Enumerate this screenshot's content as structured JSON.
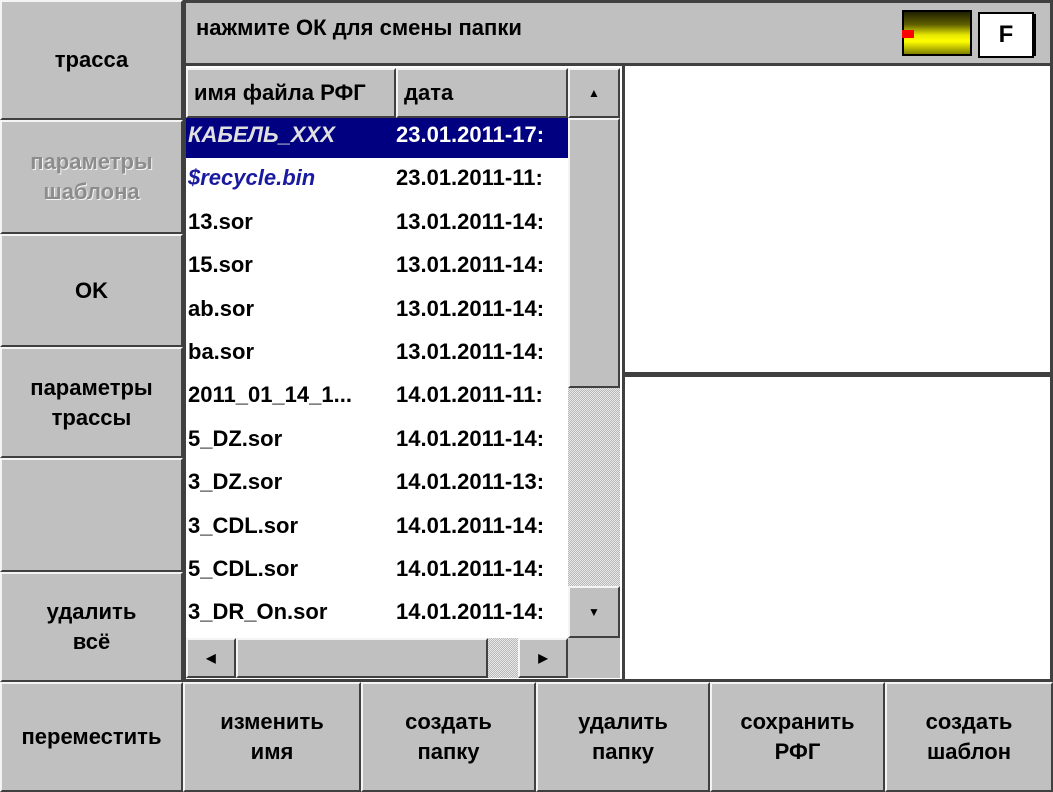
{
  "left_menu": [
    {
      "label": "трасса",
      "disabled": false
    },
    {
      "label": "параметры\nшаблона",
      "disabled": true
    },
    {
      "label": "OK",
      "disabled": false
    },
    {
      "label": "параметры\nтрассы",
      "disabled": false
    },
    {
      "label": "",
      "disabled": false
    },
    {
      "label": "удалить\nвсё",
      "disabled": false
    }
  ],
  "bottom_menu": [
    {
      "label": "переместить"
    },
    {
      "label": "изменить\nимя"
    },
    {
      "label": "создать\nпапку"
    },
    {
      "label": "удалить\nпапку"
    },
    {
      "label": "сохранить\nРФГ"
    },
    {
      "label": "создать\nшаблон"
    }
  ],
  "title_text": "нажмите ОК для смены папки",
  "f_button": "F",
  "file_list": {
    "col_name": "имя файла РФГ",
    "col_date": "дата",
    "rows": [
      {
        "name": "КАБЕЛЬ_XXX",
        "date": "23.01.2011-17:",
        "type": "selected"
      },
      {
        "name": "$recycle.bin",
        "date": "23.01.2011-11:",
        "type": "dir"
      },
      {
        "name": "13.sor",
        "date": "13.01.2011-14:",
        "type": "file"
      },
      {
        "name": "15.sor",
        "date": "13.01.2011-14:",
        "type": "file"
      },
      {
        "name": "ab.sor",
        "date": "13.01.2011-14:",
        "type": "file"
      },
      {
        "name": "ba.sor",
        "date": "13.01.2011-14:",
        "type": "file"
      },
      {
        "name": "2011_01_14_1...",
        "date": "14.01.2011-11:",
        "type": "file"
      },
      {
        "name": "5_DZ.sor",
        "date": "14.01.2011-14:",
        "type": "file"
      },
      {
        "name": "3_DZ.sor",
        "date": "14.01.2011-13:",
        "type": "file"
      },
      {
        "name": "3_CDL.sor",
        "date": "14.01.2011-14:",
        "type": "file"
      },
      {
        "name": "5_CDL.sor",
        "date": "14.01.2011-14:",
        "type": "file"
      },
      {
        "name": "3_DR_On.sor",
        "date": "14.01.2011-14:",
        "type": "file"
      }
    ]
  },
  "scroll_arrows": {
    "up": "▲",
    "down": "▼",
    "left": "◀",
    "right": "▶"
  },
  "icons": {
    "level_indicator": "signal-level-icon"
  }
}
